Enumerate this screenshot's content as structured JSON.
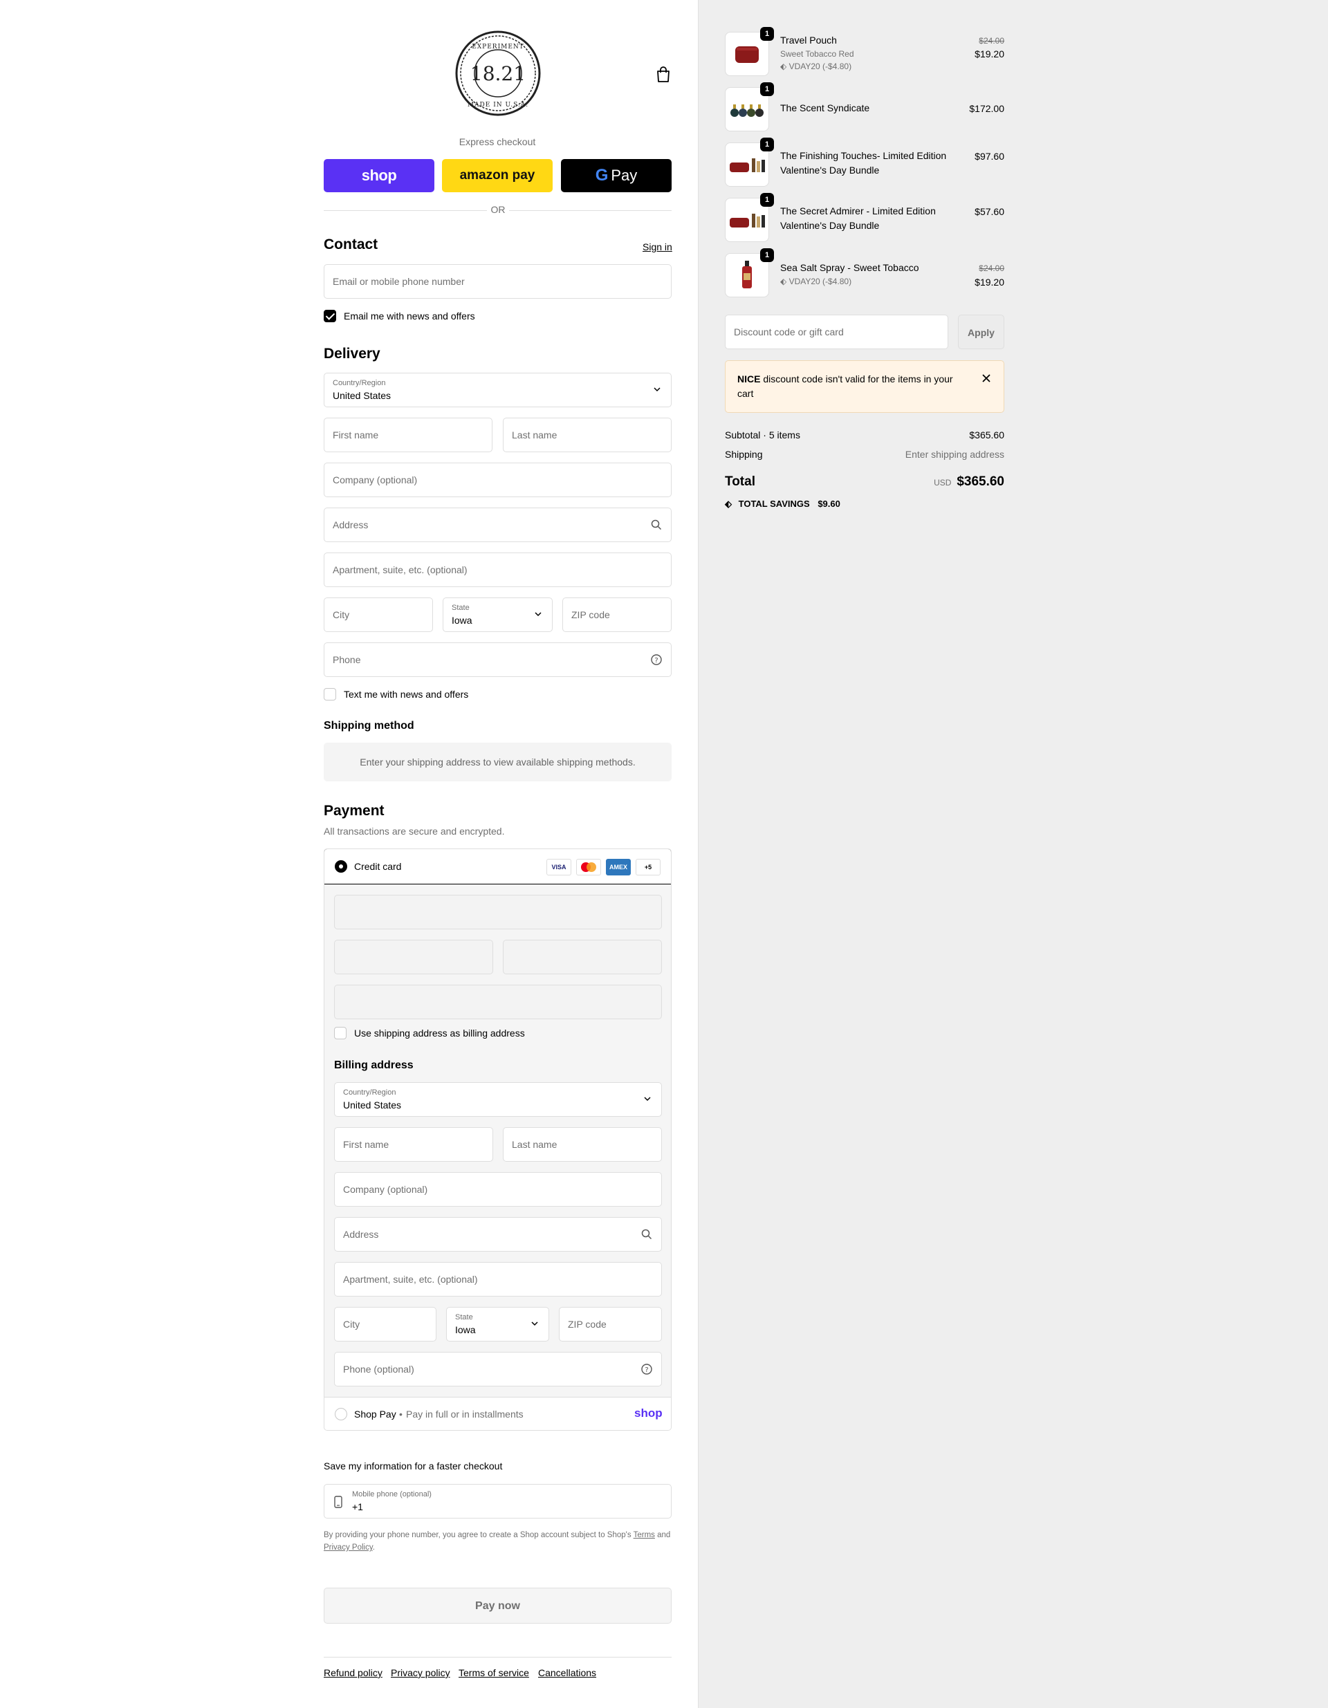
{
  "header": {
    "logo_text": "18.21 MAN+ BITTERS EXPERIMENT MADE IN U.S.A.",
    "express_label": "Express checkout",
    "shop_btn": "shop",
    "amazon_btn": "amazon pay",
    "gpay_btn": "Pay",
    "or_text": "OR"
  },
  "contact": {
    "title": "Contact",
    "sign_in": "Sign in",
    "email_placeholder": "Email or mobile phone number",
    "news_label": "Email me with news and offers",
    "news_checked": true
  },
  "delivery": {
    "title": "Delivery",
    "country_label": "Country/Region",
    "country_value": "United States",
    "first_name": "First name",
    "last_name": "Last name",
    "company": "Company (optional)",
    "address": "Address",
    "apartment": "Apartment, suite, etc. (optional)",
    "city": "City",
    "state_label": "State",
    "state_value": "Iowa",
    "zip": "ZIP code",
    "phone": "Phone",
    "text_label": "Text me with news and offers"
  },
  "shipping_method": {
    "title": "Shipping method",
    "message": "Enter your shipping address to view available shipping methods."
  },
  "payment": {
    "title": "Payment",
    "subtitle": "All transactions are secure and encrypted.",
    "credit_card": "Credit card",
    "card_logos": [
      "VISA",
      "MC",
      "AMEX",
      "+5"
    ],
    "billing_same": "Use shipping address as billing address",
    "billing_title": "Billing address",
    "billing_phone": "Phone (optional)",
    "shop_pay": "Shop Pay",
    "shop_pay_desc": "Pay in full or in installments",
    "shop_pay_logo": "shop"
  },
  "save_info": {
    "title": "Save my information for a faster checkout",
    "mobile_label": "Mobile phone (optional)",
    "mobile_value": "+1",
    "terms_prefix": "By providing your phone number, you agree to create a Shop account subject to Shop's",
    "terms_link": "Terms",
    "and": "and",
    "privacy_link": "Privacy Policy",
    "period": "."
  },
  "pay_now": "Pay now",
  "footer": [
    "Refund policy",
    "Privacy policy",
    "Terms of service",
    "Cancellations"
  ],
  "cart": {
    "items": [
      {
        "name": "Travel Pouch",
        "variant": "Sweet Tobacco Red",
        "discount": "VDAY20 (-$4.80)",
        "old_price": "$24.00",
        "price": "$19.20",
        "qty": "1"
      },
      {
        "name": "The Scent Syndicate",
        "price": "$172.00",
        "qty": "1"
      },
      {
        "name": "The Finishing Touches- Limited Edition Valentine's Day Bundle",
        "price": "$97.60",
        "qty": "1"
      },
      {
        "name": "The Secret Admirer - Limited Edition Valentine's Day Bundle",
        "price": "$57.60",
        "qty": "1"
      },
      {
        "name": "Sea Salt Spray - Sweet Tobacco",
        "discount": "VDAY20 (-$4.80)",
        "old_price": "$24.00",
        "price": "$19.20",
        "qty": "1"
      }
    ],
    "discount_placeholder": "Discount code or gift card",
    "apply": "Apply",
    "warning_code": "NICE",
    "warning_text": "discount code isn't valid for the items in your cart",
    "subtotal_label": "Subtotal · 5 items",
    "subtotal_value": "$365.60",
    "shipping_label": "Shipping",
    "shipping_value": "Enter shipping address",
    "total_label": "Total",
    "total_currency": "USD",
    "total_value": "$365.60",
    "savings_label": "TOTAL SAVINGS",
    "savings_value": "$9.60"
  },
  "colors": {
    "shop_purple": "#5a31f4",
    "amazon_yellow": "#ffd814",
    "warning_bg": "#fff4e6",
    "right_bg": "#eeeeee"
  }
}
